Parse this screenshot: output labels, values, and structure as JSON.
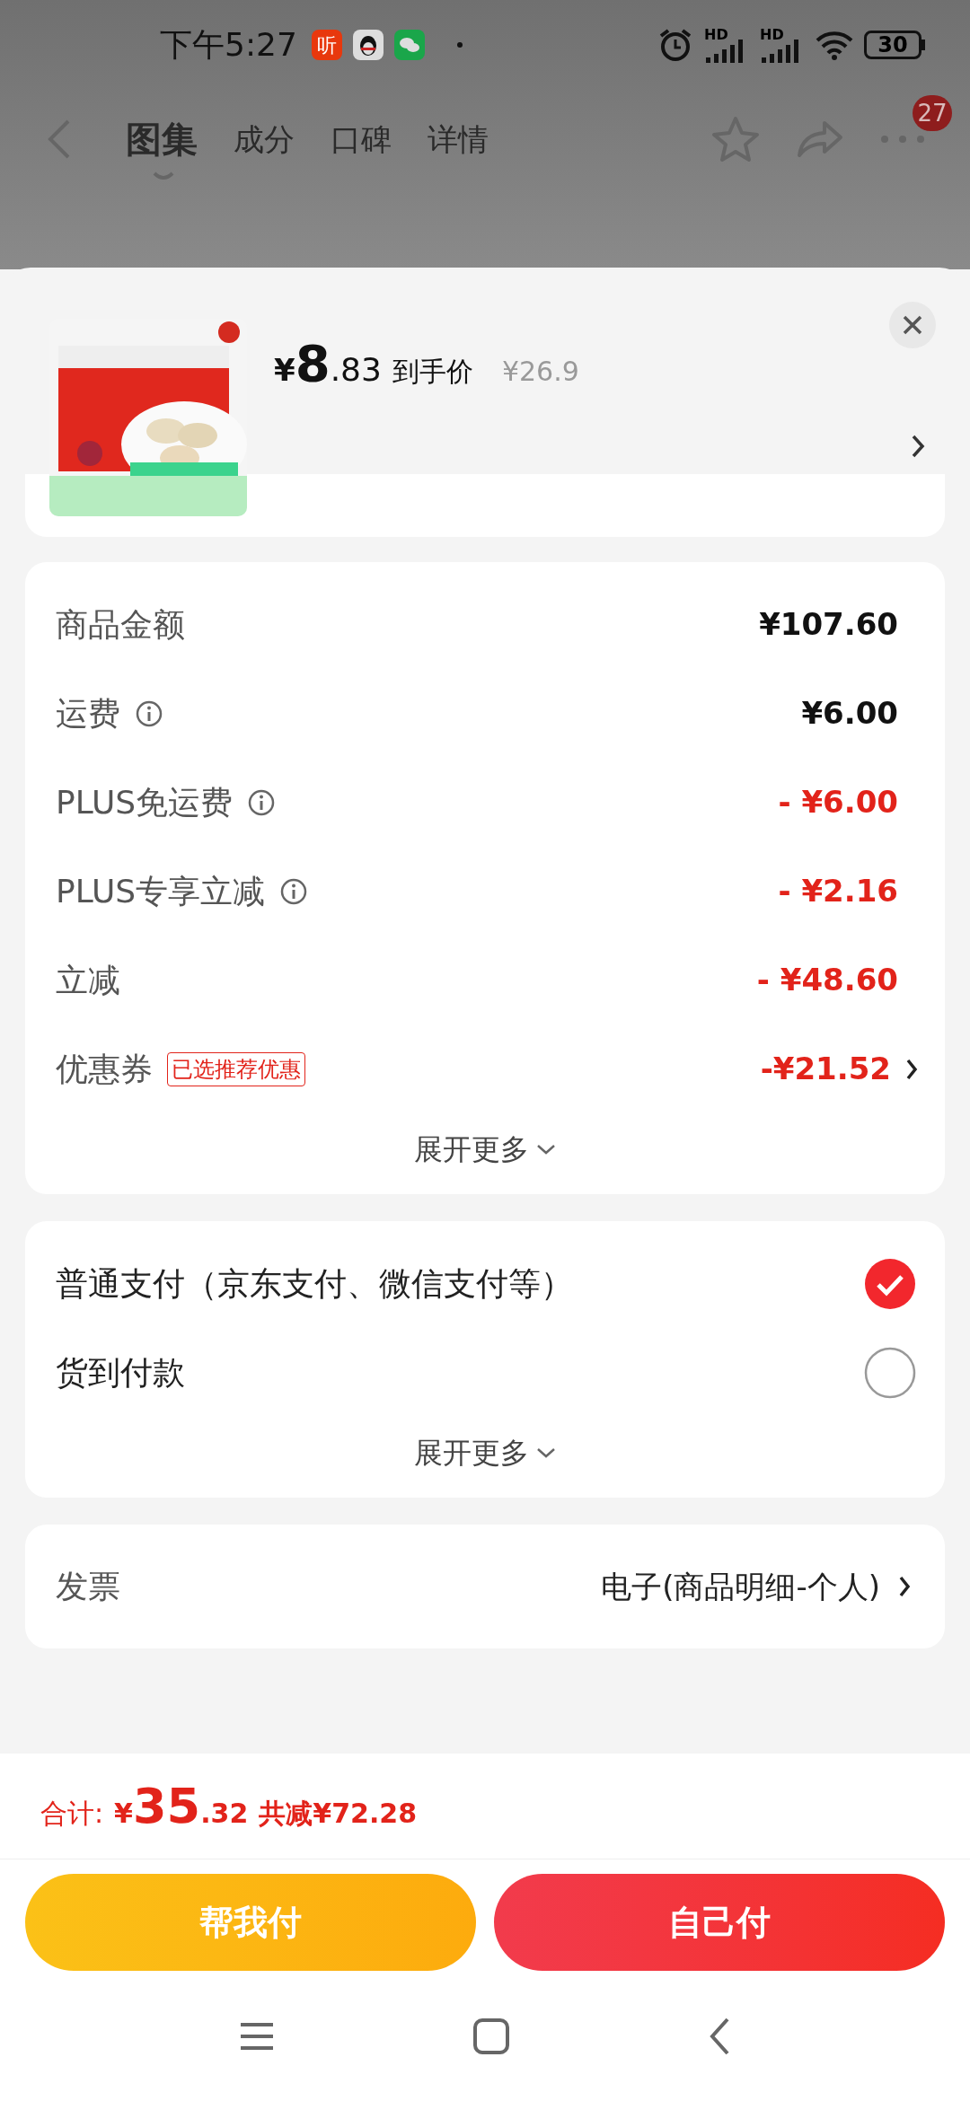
{
  "status_bar": {
    "time": "下午5:27",
    "notification_icons": [
      {
        "kind": "listen",
        "glyph": "听"
      },
      {
        "kind": "penguin"
      },
      {
        "kind": "chat"
      }
    ],
    "network_labels": [
      "HD",
      "HD"
    ],
    "battery": "30"
  },
  "nav": {
    "tabs": [
      {
        "label": "图集",
        "selected": true
      },
      {
        "label": "成分",
        "selected": false
      },
      {
        "label": "口碑",
        "selected": false
      },
      {
        "label": "详情",
        "selected": false
      }
    ],
    "badge": "27"
  },
  "product": {
    "currency": "¥",
    "price_int": "8",
    "price_dec": ".83",
    "price_label": "到手价",
    "original_price": "¥26.9"
  },
  "fees": [
    {
      "label": "商品金额",
      "value": "¥107.60",
      "kind": "plain",
      "info": false
    },
    {
      "label": "运费",
      "value": "¥6.00",
      "kind": "plain",
      "info": true
    },
    {
      "label": "PLUS免运费",
      "value": "- ¥6.00",
      "kind": "discount",
      "info": true
    },
    {
      "label": "PLUS专享立减",
      "value": "- ¥2.16",
      "kind": "discount",
      "info": true
    },
    {
      "label": "立减",
      "value": "- ¥48.60",
      "kind": "discount",
      "info": false
    },
    {
      "label": "优惠券",
      "value": "-¥21.52",
      "kind": "coupon",
      "info": false,
      "tag": "已选推荐优惠"
    }
  ],
  "fees_more": "展开更多",
  "payments": [
    {
      "label": "普通支付（京东支付、微信支付等）",
      "selected": true
    },
    {
      "label": "货到付款",
      "selected": false
    }
  ],
  "payments_more": "展开更多",
  "invoice": {
    "label": "发票",
    "value": "电子(商品明细-个人)"
  },
  "total": {
    "label": "合计:",
    "currency": "¥",
    "int": "35",
    "dec": ".32",
    "saving": "共减¥72.28"
  },
  "buttons": [
    {
      "label": "帮我付",
      "kind": "secondary"
    },
    {
      "label": "自己付",
      "kind": "primary"
    }
  ]
}
